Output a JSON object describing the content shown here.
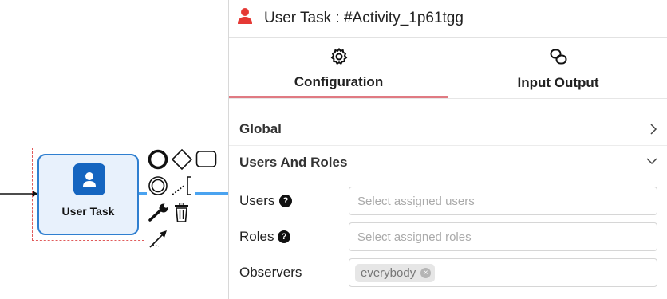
{
  "canvas": {
    "task": {
      "label": "User Task",
      "icon": "user-task-icon"
    },
    "context_pad": [
      "end-event",
      "gateway",
      "task",
      "intermediate-event",
      "text-annotation",
      "change-type",
      "delete",
      "connect"
    ]
  },
  "panel": {
    "header": {
      "icon": "user-icon",
      "title": "User Task : #Activity_1p61tgg",
      "icon_color": "#e53935"
    },
    "tabs": [
      {
        "label": "Configuration",
        "icon": "gear-icon",
        "active": true
      },
      {
        "label": "Input Output",
        "icon": "link-icon",
        "active": false
      }
    ],
    "groups": [
      {
        "label": "Global",
        "expanded": false
      },
      {
        "label": "Users And Roles",
        "expanded": true
      }
    ],
    "fields": {
      "users": {
        "label": "Users",
        "placeholder": "Select assigned users",
        "value": ""
      },
      "roles": {
        "label": "Roles",
        "placeholder": "Select assigned roles",
        "value": ""
      },
      "observers": {
        "label": "Observers",
        "tags": [
          "everybody"
        ]
      }
    }
  },
  "colors": {
    "accent": "#e07a82",
    "task_border": "#2f7fd0",
    "task_fill": "#e8f1fc",
    "task_icon": "#1565c0"
  }
}
